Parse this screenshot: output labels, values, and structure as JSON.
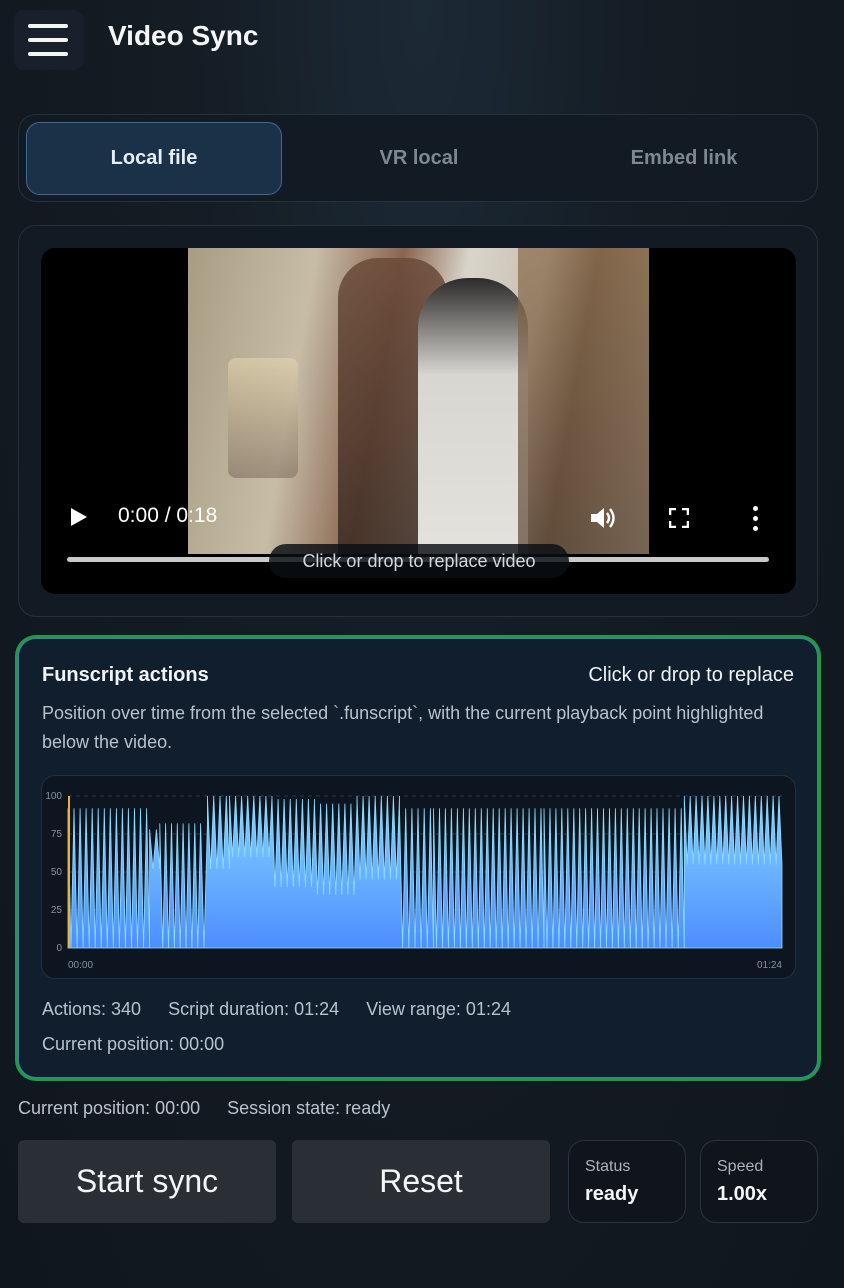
{
  "app": {
    "title": "Video Sync"
  },
  "tabs": [
    {
      "label": "Local file",
      "active": true
    },
    {
      "label": "VR local",
      "active": false
    },
    {
      "label": "Embed link",
      "active": false
    }
  ],
  "video": {
    "time": "0:00 / 0:18",
    "replace_hint": "Click or drop to replace video",
    "progress": 0
  },
  "funscript": {
    "title": "Funscript actions",
    "replace_hint": "Click or drop to replace",
    "description": "Position over time from the selected `.funscript`, with the current playback point highlighted below the video.",
    "stats": {
      "actions": "Actions: 340",
      "duration": "Script duration: 01:24",
      "view_range": "View range: 01:24"
    },
    "current_position": "Current position: 00:00"
  },
  "chart_data": {
    "type": "area",
    "x_ticks": [
      "00:00",
      "01:24"
    ],
    "y_ticks": [
      "100",
      "75",
      "50",
      "25",
      "0"
    ],
    "ylim": [
      0,
      100
    ],
    "xlim_seconds": [
      0,
      84
    ],
    "segments": [
      {
        "start": 0,
        "end": 9.6,
        "high": 92,
        "low": 0
      },
      {
        "start": 9.6,
        "end": 10.8,
        "high": 78,
        "low": 52
      },
      {
        "start": 10.8,
        "end": 15.6,
        "high": 82,
        "low": 0
      },
      {
        "start": 15.6,
        "end": 16.4,
        "high": 82,
        "low": 0
      },
      {
        "start": 16.4,
        "end": 19,
        "high": 100,
        "low": 52
      },
      {
        "start": 19,
        "end": 24,
        "high": 100,
        "low": 60
      },
      {
        "start": 24,
        "end": 29,
        "high": 98,
        "low": 40
      },
      {
        "start": 29,
        "end": 34,
        "high": 95,
        "low": 35
      },
      {
        "start": 34,
        "end": 39,
        "high": 100,
        "low": 45
      },
      {
        "start": 39,
        "end": 43,
        "high": 92,
        "low": 0
      },
      {
        "start": 43,
        "end": 56,
        "high": 92,
        "low": 0
      },
      {
        "start": 56,
        "end": 70,
        "high": 92,
        "low": 0
      },
      {
        "start": 70,
        "end": 72.5,
        "high": 92,
        "low": 0
      },
      {
        "start": 72.5,
        "end": 84,
        "high": 100,
        "low": 55
      }
    ]
  },
  "session": {
    "current_position": "Current position: 00:00",
    "state": "Session state: ready"
  },
  "buttons": {
    "start": "Start sync",
    "reset": "Reset"
  },
  "stat_status": {
    "label": "Status",
    "value": "ready"
  },
  "stat_speed": {
    "label": "Speed",
    "value": "1.00x"
  }
}
